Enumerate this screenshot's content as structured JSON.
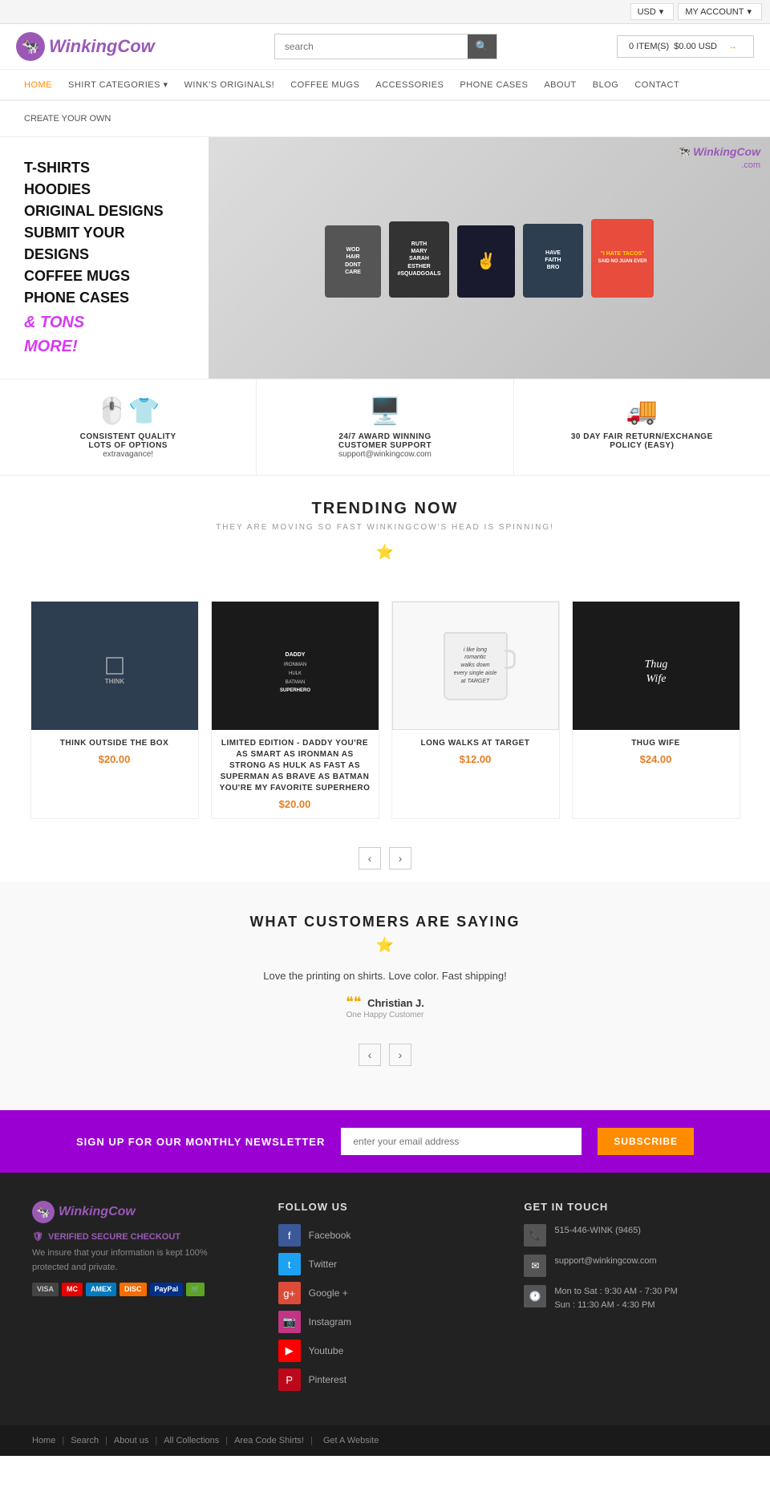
{
  "topbar": {
    "currency": "USD",
    "currency_arrow": "▾",
    "account": "MY ACCOUNT",
    "account_arrow": "▾"
  },
  "header": {
    "logo_text": "WinkingCow",
    "logo_icon": "🐄",
    "search_placeholder": "search",
    "search_btn": "🔍",
    "cart_label": "0 ITEM(S)",
    "cart_price": "$0.00 USD",
    "cart_arrow": "→"
  },
  "nav": {
    "items": [
      {
        "label": "HOME",
        "active": true
      },
      {
        "label": "SHIRT CATEGORIES",
        "dropdown": true
      },
      {
        "label": "WINK'S ORIGINALS!",
        "dropdown": false
      },
      {
        "label": "COFFEE MUGS",
        "dropdown": false
      },
      {
        "label": "ACCESSORIES",
        "dropdown": false
      },
      {
        "label": "PHONE CASES",
        "dropdown": false
      },
      {
        "label": "ABOUT",
        "dropdown": false
      },
      {
        "label": "BLOG",
        "dropdown": false
      },
      {
        "label": "CONTACT",
        "dropdown": false
      }
    ],
    "sub_item": "CREATE YOUR OWN"
  },
  "hero": {
    "lines": [
      "T-SHIRTS",
      "HOODIES",
      "ORIGINAL DESIGNS",
      "SUBMIT YOUR DESIGNS",
      "COFFEE MUGS",
      "PHONE CASES"
    ],
    "tons_text": "& TONS",
    "more_text": "MORE!",
    "overlay_logo": "WinkingCow",
    "overlay_domain": ".com",
    "shirts": [
      {
        "text": "WOD\nHAIR\nDONT\nCARE",
        "bg": "#555555"
      },
      {
        "text": "RUTH\nMARY\nSARAH\nESTHER\n#SQUADGOALS",
        "bg": "#333333"
      },
      {
        "text": "✌",
        "bg": "#1a1a2e"
      },
      {
        "text": "HAVE\nFAITH\nBRO",
        "bg": "#2c3e50"
      },
      {
        "text": "\"I HATE TACOS\"\nSAID NO JUAN EVER",
        "bg": "#e74c3c"
      }
    ]
  },
  "features": [
    {
      "icon": "👕",
      "title": "CONSISTENT QUALITY",
      "subtitle": "LOTS OF OPTIONS",
      "desc": "extravagance!"
    },
    {
      "icon": "🖥️",
      "title": "24/7 AWARD WINNING",
      "subtitle": "CUSTOMER SUPPORT",
      "desc": "support@winkingcow.com"
    },
    {
      "icon": "🚚",
      "title": "30 DAY FAIR RETURN/EXCHANGE",
      "subtitle": "POLICY (easy)",
      "desc": ""
    }
  ],
  "trending": {
    "title": "TRENDING NOW",
    "subtitle": "THEY ARE MOVING SO FAST WINKINGCOW'S HEAD IS SPINNING!",
    "star": "★"
  },
  "products": [
    {
      "name": "THINK OUTSIDE THE BOX",
      "price": "$20.00",
      "bg": "#2c3e50",
      "text": "THINK",
      "type": "tshirt"
    },
    {
      "name": "LIMITED EDITION - DADDY YOU'RE AS SMART AS IRONMAN AS STRONG AS HULK AS FAST AS SUPERMAN AS BRAVE AS BATMAN YOU'RE MY FAVORITE SUPERHERO",
      "price": "$20.00",
      "bg": "#1a1a1a",
      "text": "DADDY\nIRONMAN\nHULK\nBATMAN\nSUPERHERO",
      "type": "tshirt"
    },
    {
      "name": "LONG WALKS AT TARGET",
      "price": "$12.00",
      "bg": "#f8f8f8",
      "text": "i like long\nromantic\nwalks down\nevery single aisle\nat TARGET",
      "type": "mug"
    },
    {
      "name": "THUG WIFE",
      "price": "$24.00",
      "bg": "#1a1a1a",
      "text": "Thug\nWife",
      "type": "tshirt"
    }
  ],
  "carousel": {
    "prev": "‹",
    "next": "›"
  },
  "testimonial": {
    "title": "WHAT CUSTOMERS ARE SAYING",
    "star": "★",
    "quote": "Love the printing on shirts. Love color. Fast shipping!",
    "author": "Christian J.",
    "role": "One Happy Customer"
  },
  "newsletter": {
    "text": "SIGN UP FOR OUR MONTHLY NEWSLETTER",
    "placeholder": "enter your email address",
    "button": "SUBSCRIBE"
  },
  "footer": {
    "logo": "WinkingCow",
    "logo_icon": "🐄",
    "secure_text": "VERIFIED SECURE CHECKOUT",
    "desc": "We insure that your information is kept 100% protected and private.",
    "payment_icons": [
      "VISA",
      "MC",
      "AMEX",
      "DISC",
      "PayPal",
      "Shopify"
    ],
    "follow": {
      "title": "FOLLOW US",
      "social": [
        {
          "name": "Facebook",
          "icon": "f",
          "class": "social-fb"
        },
        {
          "name": "Twitter",
          "icon": "t",
          "class": "social-tw"
        },
        {
          "name": "Google +",
          "icon": "g+",
          "class": "social-gp"
        },
        {
          "name": "Instagram",
          "icon": "📷",
          "class": "social-ig"
        },
        {
          "name": "Youtube",
          "icon": "▶",
          "class": "social-yt"
        },
        {
          "name": "Pinterest",
          "icon": "P",
          "class": "social-pi"
        }
      ]
    },
    "contact": {
      "title": "GET IN TOUCH",
      "items": [
        {
          "icon": "📞",
          "text": "515-446-WINK (9465)"
        },
        {
          "icon": "✉",
          "text": "support@winkingcow.com"
        },
        {
          "icon": "🕐",
          "text": "Mon to Sat : 9:30 AM - 7:30 PM\nSun : 11:30 AM - 4:30 PM"
        }
      ]
    }
  },
  "footer_bottom": {
    "links": [
      "Home",
      "Search",
      "About us",
      "All Collections",
      "Area Code Shirts!",
      "Get A Website"
    ]
  }
}
